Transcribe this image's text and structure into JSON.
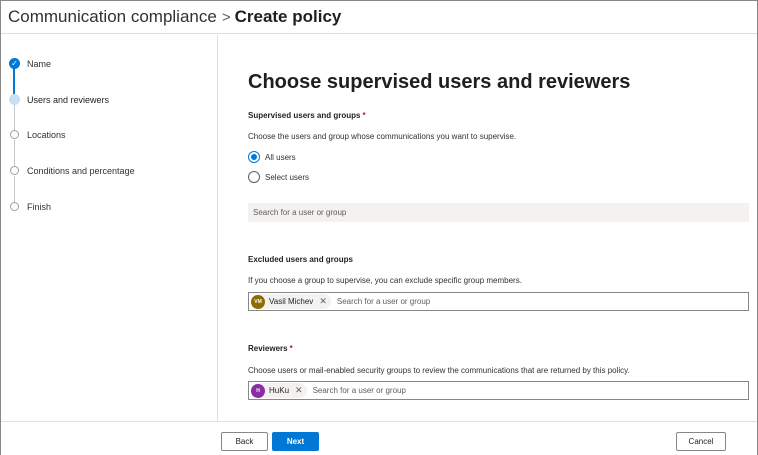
{
  "breadcrumb": {
    "parent": "Communication compliance",
    "separator": ">",
    "current": "Create policy"
  },
  "steps": [
    {
      "label": "Name",
      "state": "complete"
    },
    {
      "label": "Users and reviewers",
      "state": "current"
    },
    {
      "label": "Locations",
      "state": "upcoming"
    },
    {
      "label": "Conditions and percentage",
      "state": "upcoming"
    },
    {
      "label": "Finish",
      "state": "upcoming"
    }
  ],
  "main": {
    "title": "Choose supervised users and reviewers",
    "supervised": {
      "label": "Supervised users and groups",
      "required_mark": "*",
      "description": "Choose the users and group whose communications you want to supervise.",
      "options": [
        {
          "label": "All users",
          "selected": true
        },
        {
          "label": "Select users",
          "selected": false
        }
      ],
      "search_placeholder": "Search for a user or group"
    },
    "excluded": {
      "label": "Excluded users and groups",
      "description": "If you choose a group to supervise, you can exclude specific group members.",
      "persona": {
        "initials": "VM",
        "name": "Vasil Michev",
        "color": "#8f6b00"
      },
      "search_placeholder": "Search for a user or group"
    },
    "reviewers": {
      "label": "Reviewers",
      "required_mark": "*",
      "description": "Choose users or mail-enabled security groups to review the communications that are returned by this policy.",
      "persona": {
        "initials": "H",
        "name": "HuKu",
        "color": "#8a2da5"
      },
      "search_placeholder": "Search for a user or group"
    }
  },
  "footer": {
    "back_label": "Back",
    "next_label": "Next",
    "cancel_label": "Cancel"
  },
  "colors": {
    "accent": "#0078d4",
    "required": "#a4262c"
  }
}
